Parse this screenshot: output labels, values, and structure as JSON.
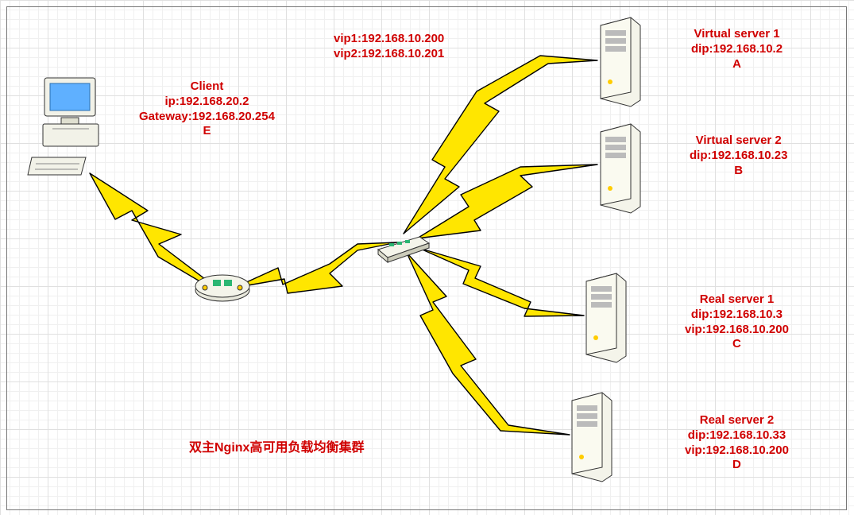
{
  "title": "双主Nginx高可用负载均衡集群",
  "vip_labels": {
    "vip1": "vip1:192.168.10.200",
    "vip2": "vip2:192.168.10.201"
  },
  "client": {
    "name": "Client",
    "ip": "ip:192.168.20.2",
    "gateway": "Gateway:192.168.20.254",
    "letter": "E"
  },
  "servers": {
    "vs1": {
      "name": "Virtual server 1",
      "dip": "dip:192.168.10.2",
      "letter": "A"
    },
    "vs2": {
      "name": "Virtual server 2",
      "dip": "dip:192.168.10.23",
      "letter": "B"
    },
    "rs1": {
      "name": "Real server 1",
      "dip": "dip:192.168.10.3",
      "vip": "vip:192.168.10.200",
      "letter": "C"
    },
    "rs2": {
      "name": "Real server 2",
      "dip": "dip:192.168.10.33",
      "vip": "vip:192.168.10.200",
      "letter": "D"
    }
  }
}
